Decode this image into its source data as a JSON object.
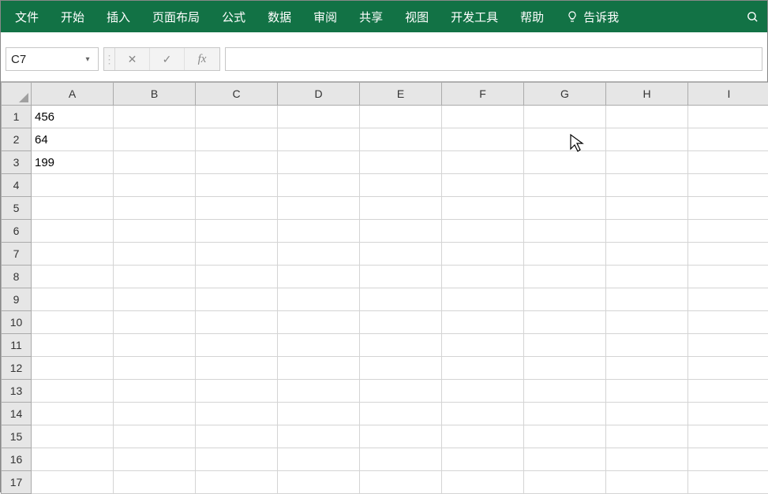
{
  "ribbon": {
    "tabs": [
      "文件",
      "开始",
      "插入",
      "页面布局",
      "公式",
      "数据",
      "审阅",
      "共享",
      "视图",
      "开发工具",
      "帮助"
    ],
    "tell_me": "告诉我"
  },
  "formula_bar": {
    "name_box": "C7",
    "dropdown_glyph": "▾",
    "sep_glyph": "⋮",
    "cancel_glyph": "✕",
    "enter_glyph": "✓",
    "fx_label": "fx",
    "input_value": ""
  },
  "grid": {
    "columns": [
      "A",
      "B",
      "C",
      "D",
      "E",
      "F",
      "G",
      "H",
      "I"
    ],
    "rows": [
      {
        "n": "1",
        "cells": [
          "456",
          "",
          "",
          "",
          "",
          "",
          "",
          "",
          ""
        ]
      },
      {
        "n": "2",
        "cells": [
          "64",
          "",
          "",
          "",
          "",
          "",
          "",
          "",
          ""
        ]
      },
      {
        "n": "3",
        "cells": [
          "199",
          "",
          "",
          "",
          "",
          "",
          "",
          "",
          ""
        ]
      },
      {
        "n": "4",
        "cells": [
          "",
          "",
          "",
          "",
          "",
          "",
          "",
          "",
          ""
        ]
      },
      {
        "n": "5",
        "cells": [
          "",
          "",
          "",
          "",
          "",
          "",
          "",
          "",
          ""
        ]
      },
      {
        "n": "6",
        "cells": [
          "",
          "",
          "",
          "",
          "",
          "",
          "",
          "",
          ""
        ]
      },
      {
        "n": "7",
        "cells": [
          "",
          "",
          "",
          "",
          "",
          "",
          "",
          "",
          ""
        ]
      },
      {
        "n": "8",
        "cells": [
          "",
          "",
          "",
          "",
          "",
          "",
          "",
          "",
          ""
        ]
      },
      {
        "n": "9",
        "cells": [
          "",
          "",
          "",
          "",
          "",
          "",
          "",
          "",
          ""
        ]
      },
      {
        "n": "10",
        "cells": [
          "",
          "",
          "",
          "",
          "",
          "",
          "",
          "",
          ""
        ]
      },
      {
        "n": "11",
        "cells": [
          "",
          "",
          "",
          "",
          "",
          "",
          "",
          "",
          ""
        ]
      },
      {
        "n": "12",
        "cells": [
          "",
          "",
          "",
          "",
          "",
          "",
          "",
          "",
          ""
        ]
      },
      {
        "n": "13",
        "cells": [
          "",
          "",
          "",
          "",
          "",
          "",
          "",
          "",
          ""
        ]
      },
      {
        "n": "14",
        "cells": [
          "",
          "",
          "",
          "",
          "",
          "",
          "",
          "",
          ""
        ]
      },
      {
        "n": "15",
        "cells": [
          "",
          "",
          "",
          "",
          "",
          "",
          "",
          "",
          ""
        ]
      },
      {
        "n": "16",
        "cells": [
          "",
          "",
          "",
          "",
          "",
          "",
          "",
          "",
          ""
        ]
      },
      {
        "n": "17",
        "cells": [
          "",
          "",
          "",
          "",
          "",
          "",
          "",
          "",
          ""
        ]
      }
    ]
  }
}
